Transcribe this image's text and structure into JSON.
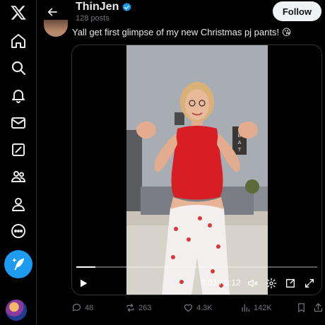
{
  "header": {
    "name": "ThinJen",
    "post_count": "128 posts",
    "follow_label": "Follow"
  },
  "nav": {
    "items": [
      "x-logo",
      "home",
      "explore",
      "notifications",
      "messages",
      "grok",
      "communities",
      "profile",
      "more",
      "post"
    ]
  },
  "tweet": {
    "text": "Yall get first glimpse of my new Christmas pj pants! 😘"
  },
  "video": {
    "time": "0:01 / 0:12",
    "progress": 0.08
  },
  "actions": {
    "replies": "48",
    "reposts": "263",
    "likes": "4.3K",
    "views": "142K"
  },
  "colors": {
    "accent": "#1d9bf0",
    "background": "#000000",
    "muted": "#71767b",
    "text": "#e7e9ea"
  }
}
